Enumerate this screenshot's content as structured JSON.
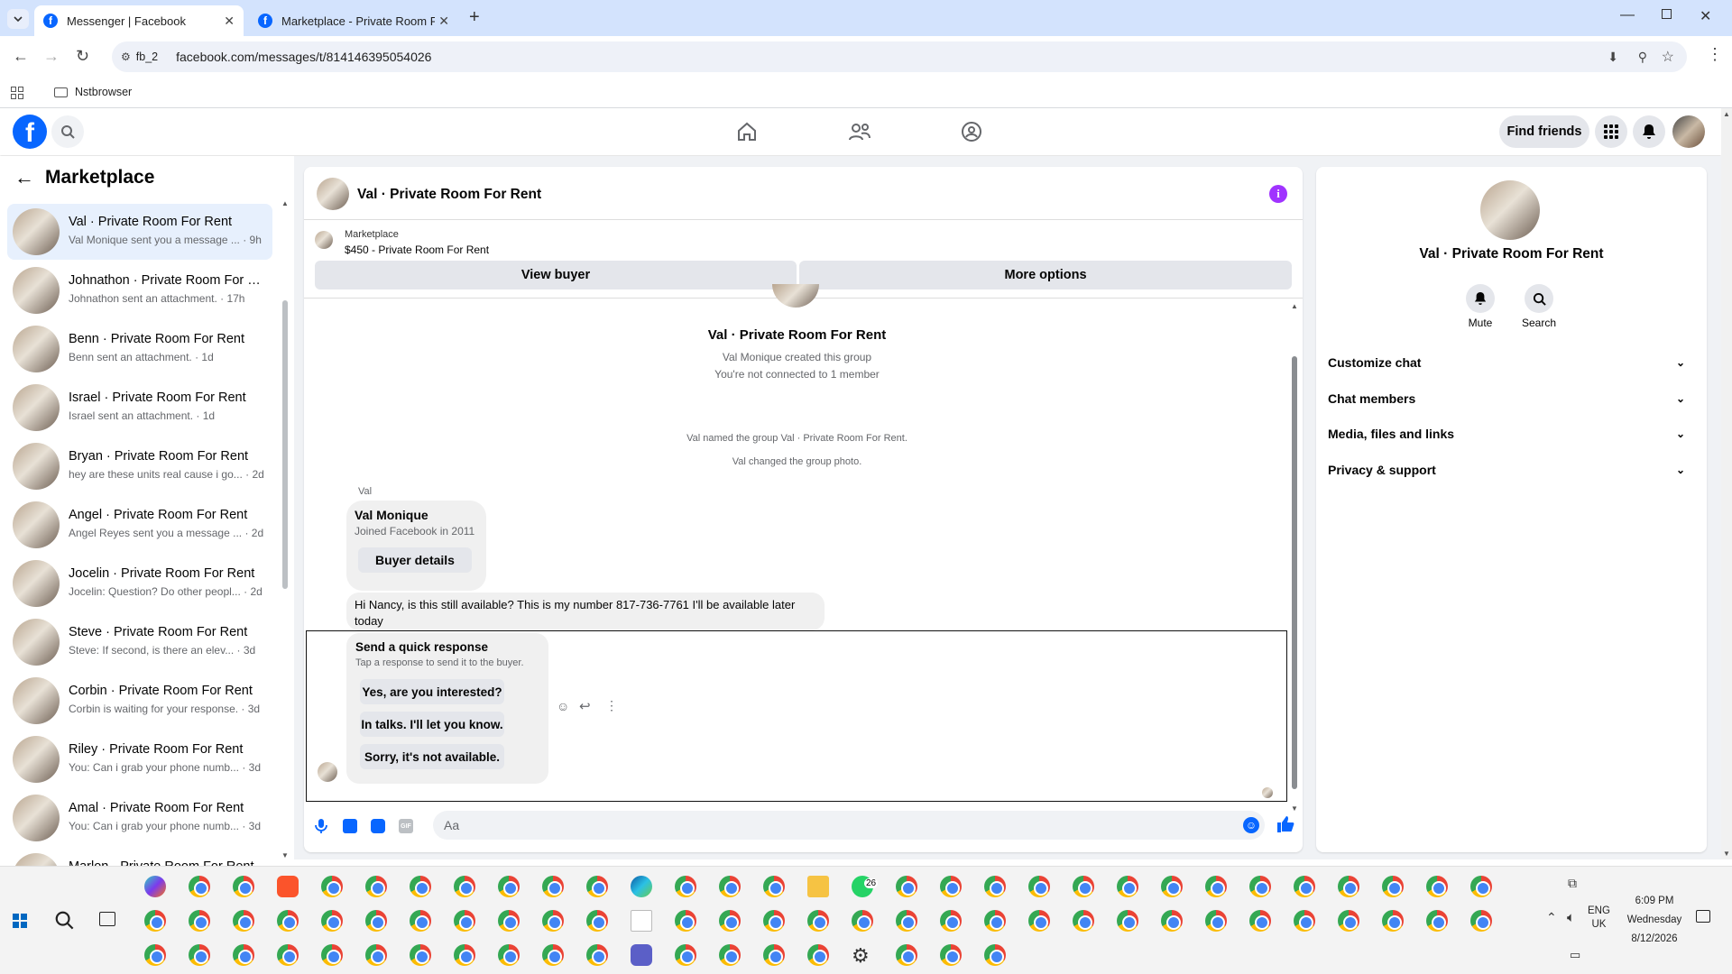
{
  "browser": {
    "tabs": [
      {
        "title": "Messenger | Facebook",
        "active": true
      },
      {
        "title": "Marketplace - Private Room For",
        "active": false
      }
    ],
    "profile_chip": "fb_2",
    "url": "facebook.com/messages/t/814146395054026",
    "bookmarks": [
      {
        "label": "Nstbrowser",
        "icon": "folder-icon"
      }
    ]
  },
  "fb_header": {
    "find_friends": "Find friends"
  },
  "sidebar": {
    "title": "Marketplace",
    "conversations": [
      {
        "name": "Val · Private Room For Rent",
        "preview": "Val Monique sent you a message ... · 9h",
        "active": true
      },
      {
        "name": "Johnathon · Private Room For R...",
        "preview": "Johnathon sent an attachment. · 17h"
      },
      {
        "name": "Benn · Private Room For Rent",
        "preview": "Benn sent an attachment. · 1d"
      },
      {
        "name": "Israel · Private Room For Rent",
        "preview": "Israel sent an attachment. · 1d"
      },
      {
        "name": "Bryan · Private Room For Rent",
        "preview": "hey are these units real cause i go... · 2d"
      },
      {
        "name": "Angel · Private Room For Rent",
        "preview": "Angel Reyes sent you a message ... · 2d"
      },
      {
        "name": "Jocelin · Private Room For Rent",
        "preview": "Jocelin: Question? Do other peopl... · 2d"
      },
      {
        "name": "Steve · Private Room For Rent",
        "preview": "Steve: If second, is there an elev... · 3d"
      },
      {
        "name": "Corbin · Private Room For Rent",
        "preview": "Corbin is waiting for your response. · 3d"
      },
      {
        "name": "Riley · Private Room For Rent",
        "preview": "You: Can i grab your phone numb... · 3d"
      },
      {
        "name": "Amal · Private Room For Rent",
        "preview": "You: Can i grab your phone numb... · 3d"
      },
      {
        "name": "Marlon · Private Room For Rent",
        "preview": ""
      }
    ]
  },
  "chat": {
    "header_title": "Val · Private Room For Rent",
    "listing": {
      "source": "Marketplace",
      "title": "$450 - Private Room For Rent"
    },
    "view_buyer": "View buyer",
    "more_options": "More options",
    "group_title": "Val · Private Room For Rent",
    "created_text": "Val Monique created this group",
    "connection_text": "You're not connected to 1 member",
    "system_1": "Val named the group Val · Private Room For Rent.",
    "system_2": "Val changed the group photo.",
    "sender_label": "Val",
    "buyer_card": {
      "name": "Val Monique",
      "joined": "Joined Facebook in 2011",
      "button": "Buyer details"
    },
    "message": "Hi Nancy, is this still available? This is my number 817-736-7761 I'll be available later today",
    "quick_response": {
      "title": "Send a quick response",
      "subtitle": "Tap a response to send it to the buyer.",
      "options": [
        "Yes, are you interested?",
        "In talks. I'll let you know.",
        "Sorry, it's not available."
      ]
    },
    "composer_placeholder": "Aa"
  },
  "info_panel": {
    "title": "Val · Private Room For Rent",
    "actions": [
      {
        "label": "Mute",
        "icon": "bell-icon"
      },
      {
        "label": "Search",
        "icon": "search-icon"
      }
    ],
    "sections": [
      "Customize chat",
      "Chat members",
      "Media, files and links",
      "Privacy & support"
    ]
  },
  "taskbar": {
    "time": "6:09 PM",
    "day": "Wednesday",
    "date": "8/12/2026",
    "lang_1": "ENG",
    "lang_2": "UK",
    "whatsapp_badge": "26"
  }
}
